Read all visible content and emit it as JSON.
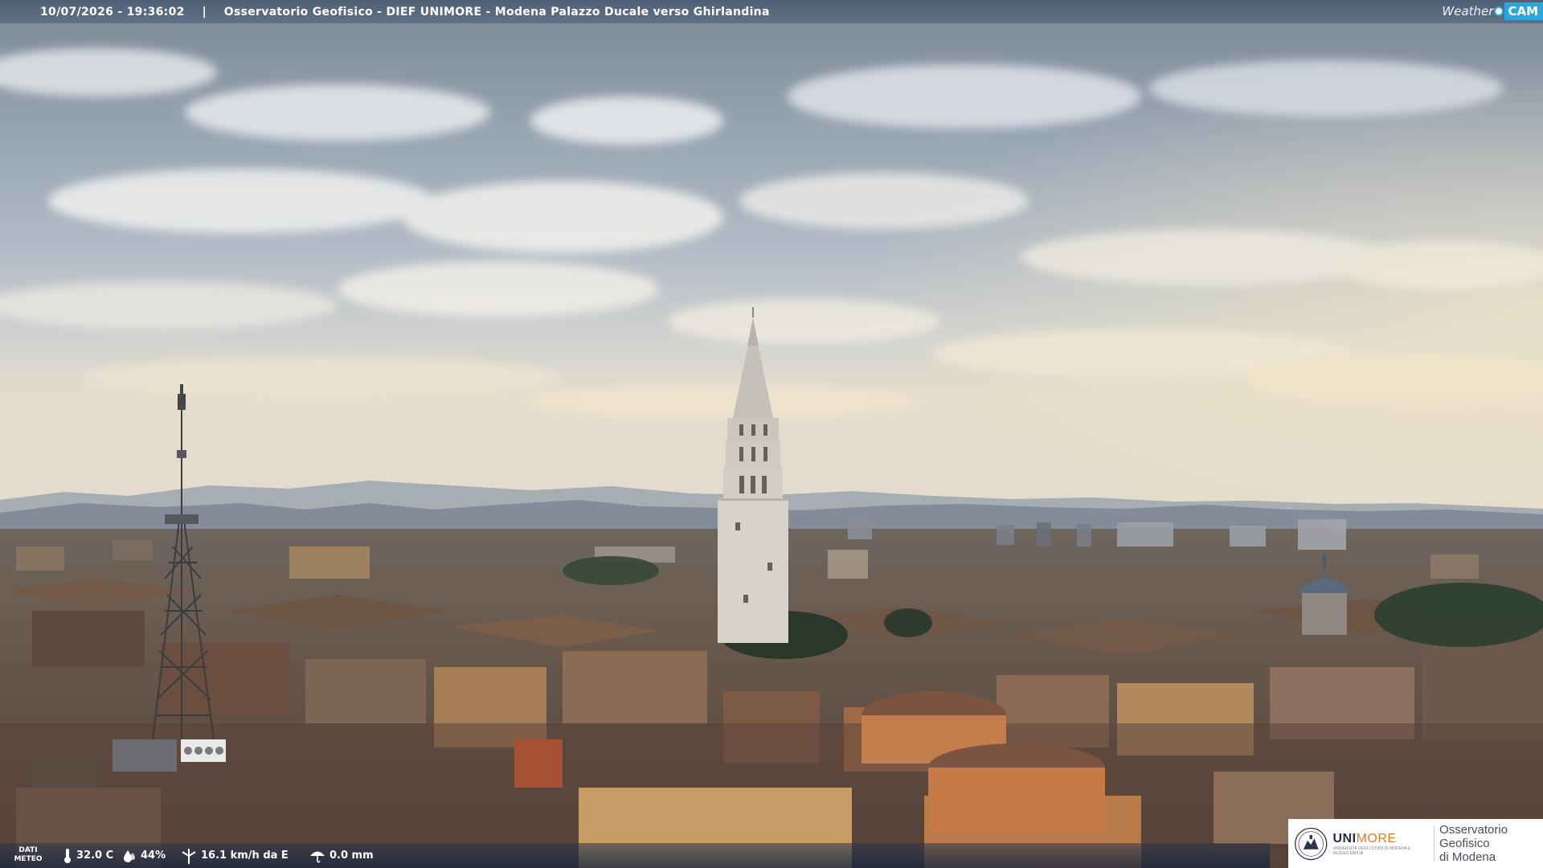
{
  "header": {
    "timestamp": "10/07/2026 - 19:36:02",
    "separator": "|",
    "title": "Osservatorio Geofisico - DIEF UNIMORE - Modena Palazzo Ducale verso Ghirlandina"
  },
  "logo": {
    "weather": "Weather",
    "cam": "CAM",
    "accent": "#2aa7e0"
  },
  "meteo": {
    "label_line1": "DATI",
    "label_line2": "METEO",
    "temperature": "32.0 C",
    "humidity": "44%",
    "wind": "16.1 km/h da E",
    "rain": "0.0 mm"
  },
  "unimore": {
    "name_part1": "UNI",
    "name_part2": "MORE",
    "subtitle": "UNIVERSITÀ DEGLI STUDI DI MODENA E REGGIO EMILIA",
    "observatory_line1": "Osservatorio Geofisico",
    "observatory_line2": "di Modena",
    "accent": "#e07a1f"
  }
}
